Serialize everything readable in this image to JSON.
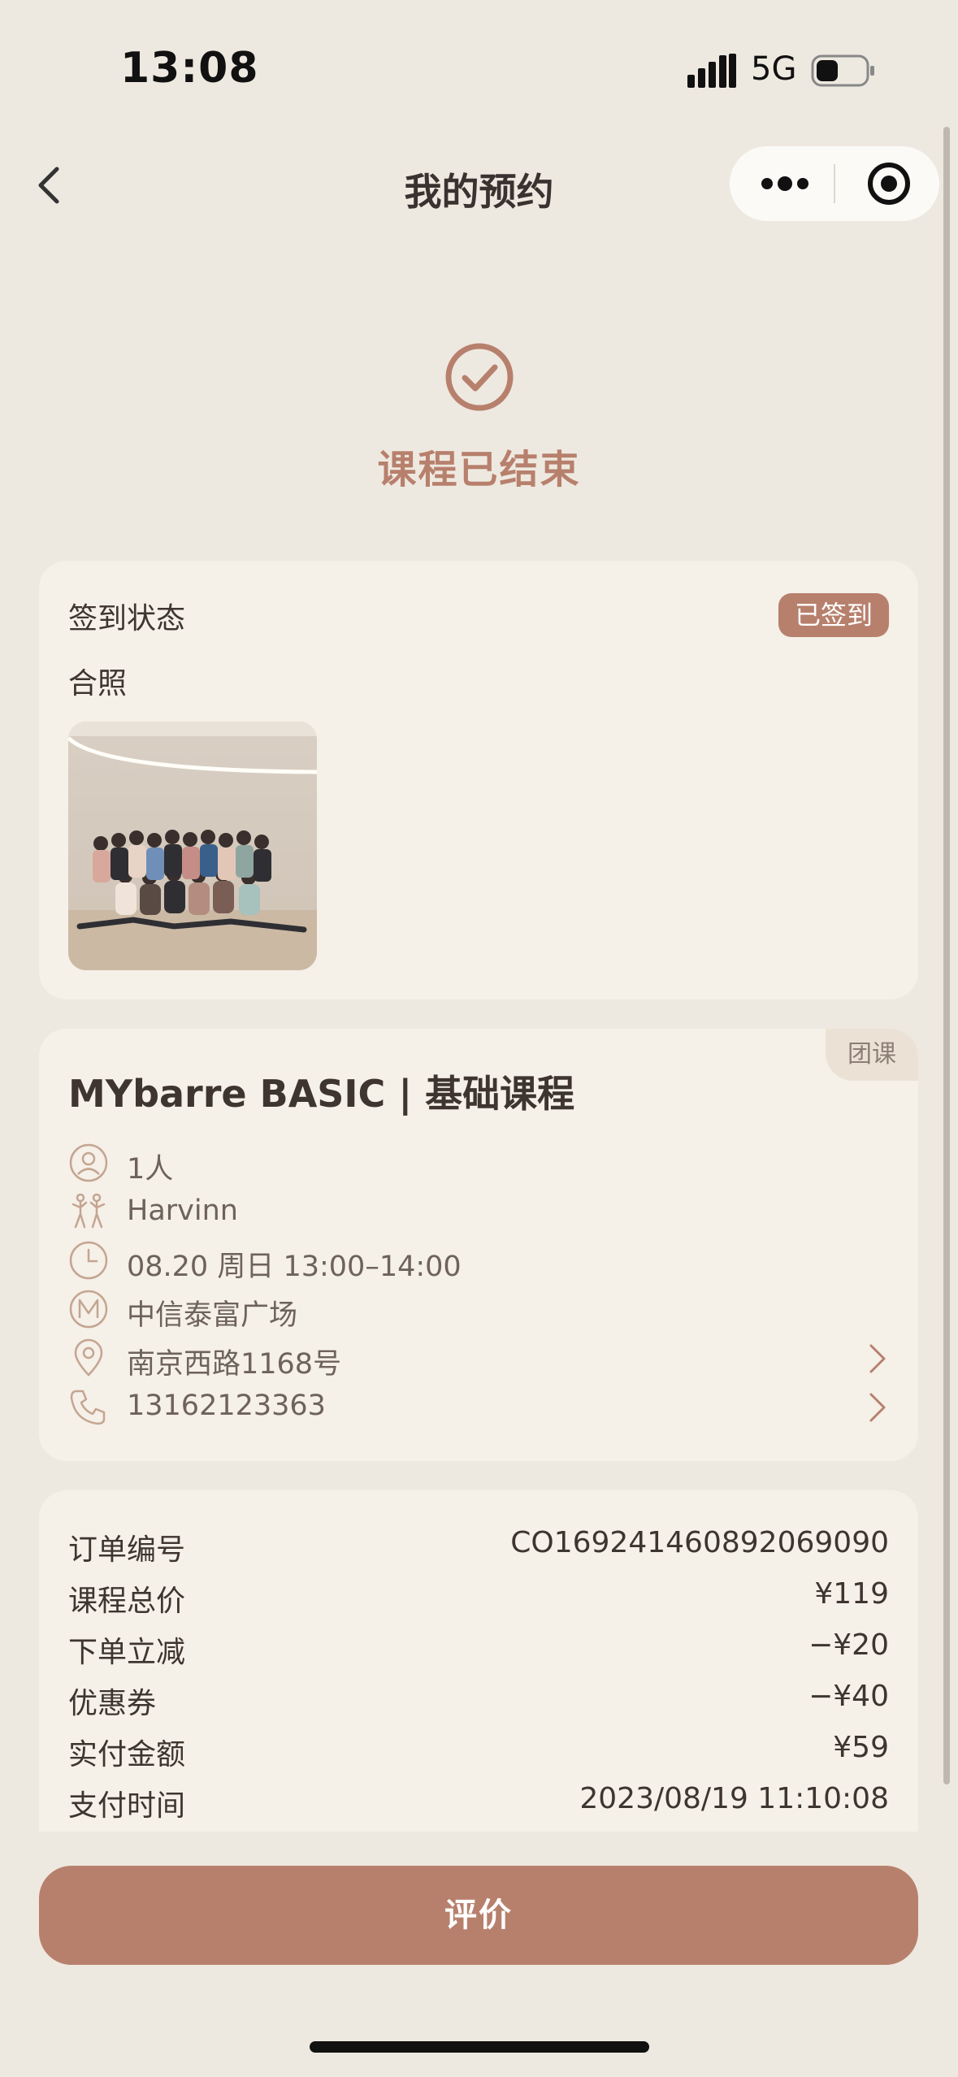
{
  "status_bar": {
    "time": "13:08",
    "network": "5G"
  },
  "nav": {
    "title": "我的预约"
  },
  "hero": {
    "status_text": "课程已结束"
  },
  "checkin_card": {
    "status_label": "签到状态",
    "status_badge": "已签到",
    "photo_label": "合照"
  },
  "course_card": {
    "tag": "团课",
    "title": "MYbarre BASIC | 基础课程",
    "people": "1人",
    "coach": "Harvinn",
    "time": "08.20 周日 13:00–14:00",
    "venue": "中信泰富广场",
    "address": "南京西路1168号",
    "phone": "13162123363"
  },
  "order_card": {
    "rows": [
      {
        "label": "订单编号",
        "value": "CO1692414608920690​90"
      },
      {
        "label": "课程总价",
        "value": "¥119"
      },
      {
        "label": "下单立减",
        "value": "−¥20"
      },
      {
        "label": "优惠券",
        "value": "−¥40"
      },
      {
        "label": "实付金额",
        "value": "¥59"
      },
      {
        "label": "支付时间",
        "value": "2023/08/19 11:10:08"
      }
    ]
  },
  "actions": {
    "evaluate": "评价"
  },
  "colors": {
    "accent": "#b7806d",
    "background": "#eee9e0",
    "card": "#f5f0e8"
  }
}
